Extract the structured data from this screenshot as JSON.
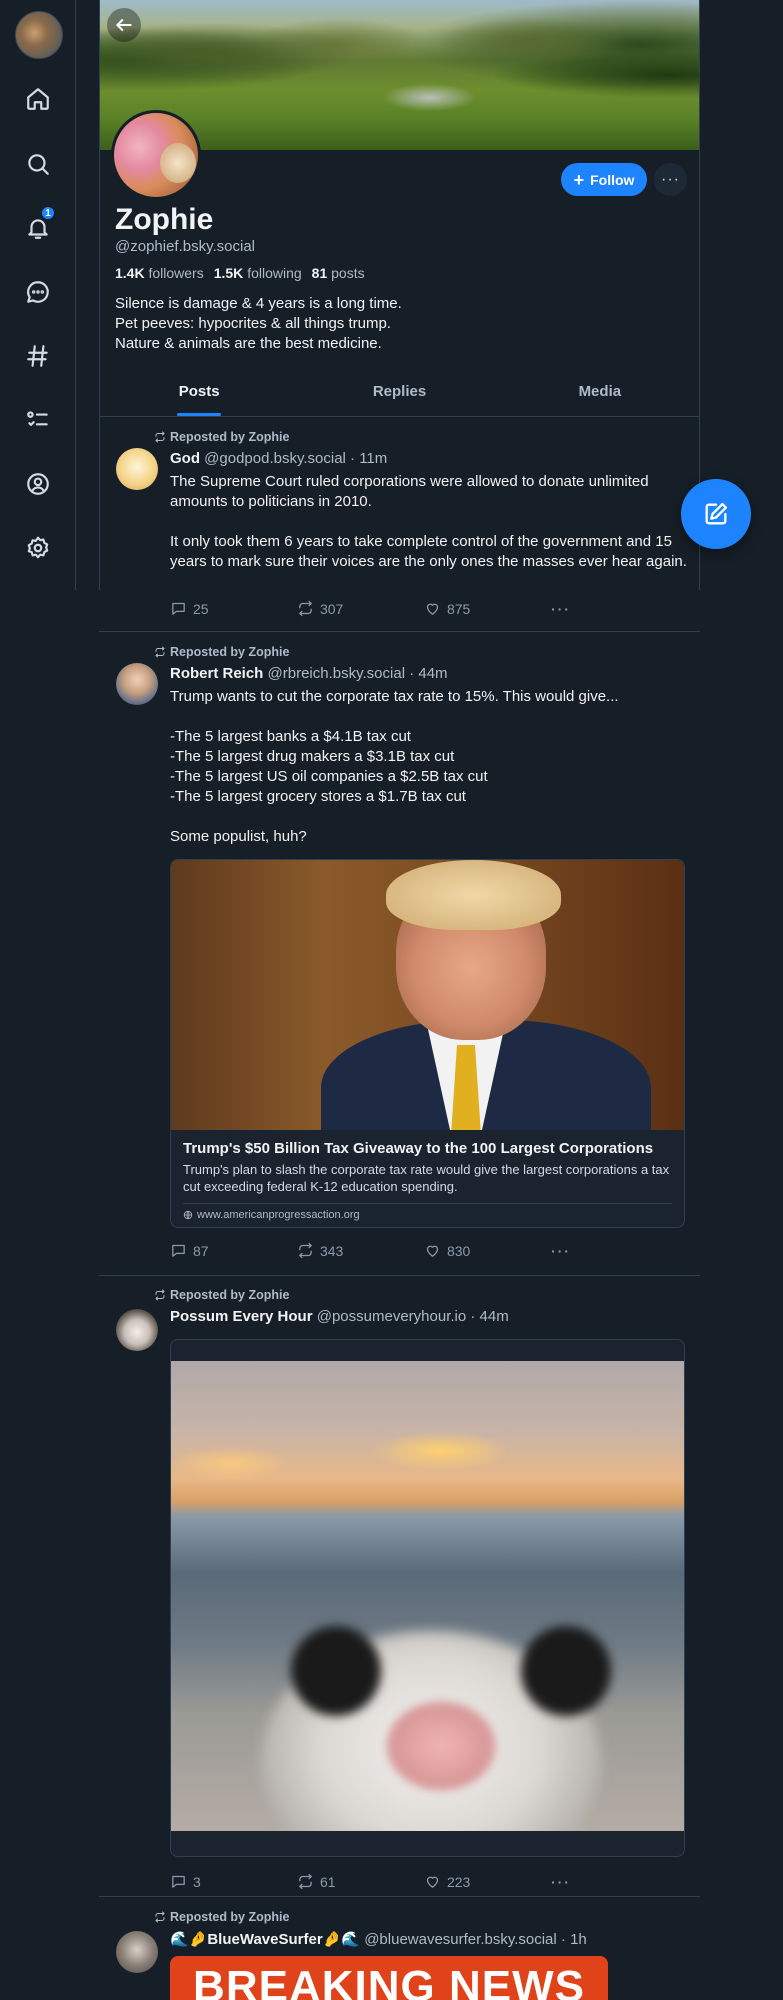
{
  "profile": {
    "display_name": "Zophie",
    "handle": "@zophief.bsky.social",
    "followers_count": "1.4K",
    "followers_label": "followers",
    "following_count": "1.5K",
    "following_label": "following",
    "posts_count": "81",
    "posts_label": "posts",
    "bio": [
      "Silence is damage & 4 years is a long time.",
      "Pet peeves: hypocrites & all things trump.",
      "Nature & animals are the best medicine."
    ],
    "follow_label": "Follow",
    "more_label": "···"
  },
  "nav": {
    "notification_badge": "1",
    "items": [
      "home-icon",
      "search-icon",
      "bell-icon",
      "chat-icon",
      "hashtag-icon",
      "list-icon",
      "profile-icon",
      "gear-icon"
    ]
  },
  "tabs": [
    {
      "label": "Posts",
      "active": true
    },
    {
      "label": "Replies",
      "active": false
    },
    {
      "label": "Media",
      "active": false
    }
  ],
  "colors": {
    "accent": "#1d83ff",
    "background": "#161e27",
    "border": "#2e4052"
  },
  "feed": [
    {
      "repost_label": "Reposted by Zophie",
      "author": "God",
      "meta": "@godpod.bsky.social · 11m",
      "text": [
        "The Supreme Court ruled corporations were allowed to donate unlimited amounts to politicians in 2010.",
        "",
        "It only took them 6 years to take complete control of the government and 15 years to mark sure their voices are the only ones the masses ever hear again."
      ],
      "replies": "25",
      "reposts": "307",
      "likes": "875"
    },
    {
      "repost_label": "Reposted by Zophie",
      "author": "Robert Reich",
      "meta": "@rbreich.bsky.social · 44m",
      "text": [
        "Trump wants to cut the corporate tax rate to 15%. This would give...",
        "",
        "-The 5 largest banks a $4.1B tax cut",
        "-The 5 largest drug makers a $3.1B tax cut",
        "-The 5 largest US oil companies a $2.5B tax cut",
        "-The 5 largest grocery stores a $1.7B tax cut",
        "",
        "Some populist, huh?"
      ],
      "link": {
        "title": "Trump's $50 Billion Tax Giveaway to the 100 Largest Corporations",
        "description": "Trump's plan to slash the corporate tax rate would give the largest corporations a tax cut exceeding federal K-12 education spending.",
        "domain": "www.americanprogressaction.org"
      },
      "replies": "87",
      "reposts": "343",
      "likes": "830"
    },
    {
      "repost_label": "Reposted by Zophie",
      "author": "Possum Every Hour",
      "meta": "@possumeveryhour.io · 44m",
      "replies": "3",
      "reposts": "61",
      "likes": "223"
    },
    {
      "repost_label": "Reposted by Zophie",
      "author": "🌊🤌BlueWaveSurfer🤌🌊",
      "meta": "@bluewavesurfer.bsky.social · 1h",
      "image_text": "BREAKING NEWS"
    }
  ],
  "more_dots": "···"
}
